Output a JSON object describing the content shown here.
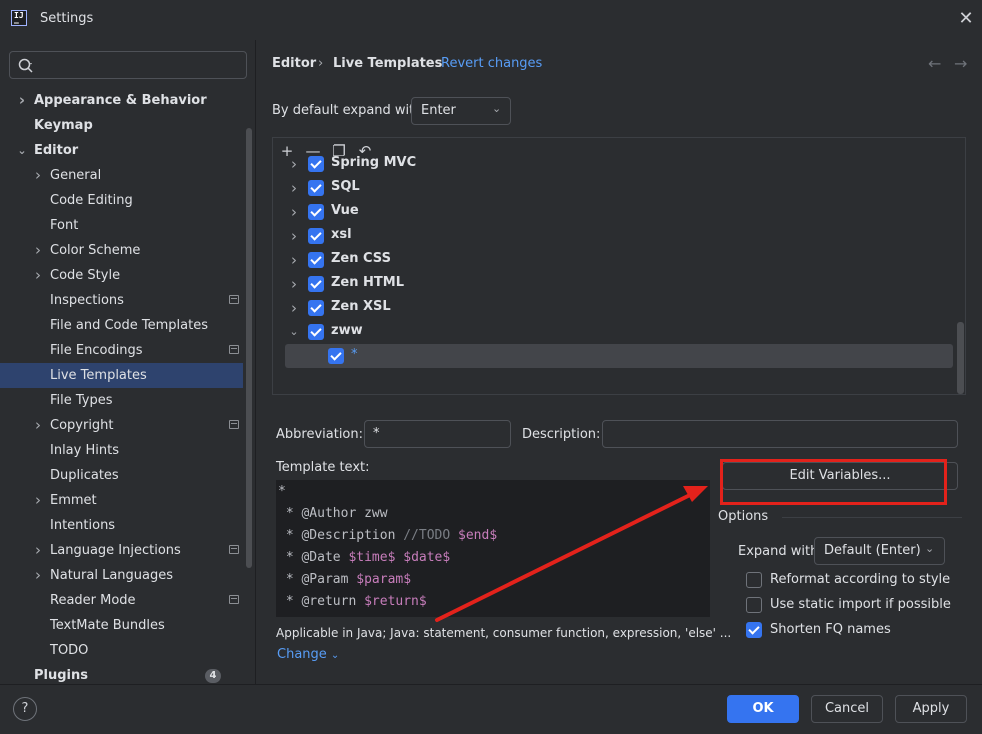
{
  "window": {
    "title": "Settings",
    "close_icon": "close-icon"
  },
  "search": {
    "placeholder": ""
  },
  "nav": {
    "items": [
      {
        "label": "Appearance & Behavior",
        "bold": true,
        "chevron": "right",
        "level": 0
      },
      {
        "label": "Keymap",
        "bold": true,
        "chevron": "",
        "level": 0
      },
      {
        "label": "Editor",
        "bold": true,
        "chevron": "down",
        "level": 0
      },
      {
        "label": "General",
        "chevron": "right",
        "level": 1
      },
      {
        "label": "Code Editing",
        "chevron": "",
        "level": 1
      },
      {
        "label": "Font",
        "chevron": "",
        "level": 1
      },
      {
        "label": "Color Scheme",
        "chevron": "right",
        "level": 1
      },
      {
        "label": "Code Style",
        "chevron": "right",
        "level": 1
      },
      {
        "label": "Inspections",
        "chevron": "",
        "level": 1,
        "indicator": true
      },
      {
        "label": "File and Code Templates",
        "chevron": "",
        "level": 1
      },
      {
        "label": "File Encodings",
        "chevron": "",
        "level": 1,
        "indicator": true
      },
      {
        "label": "Live Templates",
        "chevron": "",
        "level": 1,
        "selected": true
      },
      {
        "label": "File Types",
        "chevron": "",
        "level": 1
      },
      {
        "label": "Copyright",
        "chevron": "right",
        "level": 1,
        "indicator": true
      },
      {
        "label": "Inlay Hints",
        "chevron": "",
        "level": 1
      },
      {
        "label": "Duplicates",
        "chevron": "",
        "level": 1
      },
      {
        "label": "Emmet",
        "chevron": "right",
        "level": 1
      },
      {
        "label": "Intentions",
        "chevron": "",
        "level": 1
      },
      {
        "label": "Language Injections",
        "chevron": "right",
        "level": 1,
        "indicator": true
      },
      {
        "label": "Natural Languages",
        "chevron": "right",
        "level": 1
      },
      {
        "label": "Reader Mode",
        "chevron": "",
        "level": 1,
        "indicator": true
      },
      {
        "label": "TextMate Bundles",
        "chevron": "",
        "level": 1
      },
      {
        "label": "TODO",
        "chevron": "",
        "level": 1
      },
      {
        "label": "Plugins",
        "bold": true,
        "chevron": "",
        "level": 0,
        "badge": "4"
      }
    ]
  },
  "breadcrumb": {
    "part1": "Editor",
    "separator": "›",
    "part2": "Live Templates",
    "revert": "Revert changes",
    "back": "←",
    "forward": "→"
  },
  "expand": {
    "label": "By default expand with",
    "value": "Enter"
  },
  "tree": {
    "toolbar": [
      {
        "icon": "add-icon",
        "glyph": "+"
      },
      {
        "icon": "remove-icon",
        "glyph": "—"
      },
      {
        "icon": "copy-icon",
        "glyph": "❐"
      },
      {
        "icon": "undo-icon",
        "glyph": "↶"
      }
    ],
    "rows": [
      {
        "label": "Spring MVC",
        "expanded": false
      },
      {
        "label": "SQL",
        "expanded": false
      },
      {
        "label": "Vue",
        "expanded": false
      },
      {
        "label": "xsl",
        "expanded": false
      },
      {
        "label": "Zen CSS",
        "expanded": false
      },
      {
        "label": "Zen HTML",
        "expanded": false
      },
      {
        "label": "Zen XSL",
        "expanded": false
      },
      {
        "label": "zww",
        "expanded": true
      },
      {
        "label": "*",
        "child": true,
        "selected": true
      }
    ]
  },
  "abbreviation": {
    "label": "Abbreviation:",
    "value": "*"
  },
  "description": {
    "label": "Description:",
    "value": ""
  },
  "template": {
    "label": "Template text:",
    "lines": [
      "*",
      " * @Author zww",
      " * @Description //TODO $end$",
      " * @Date $time$ $date$",
      " * @Param $param$",
      " * @return $return$"
    ]
  },
  "applicable": {
    "text": "Applicable in Java; Java: statement, consumer function, expression, 'else' ...",
    "change": "Change"
  },
  "edit_variables": {
    "label": "Edit Variables..."
  },
  "options": {
    "title": "Options",
    "expand_label": "Expand with",
    "expand_value": "Default (Enter)",
    "checks": [
      {
        "label": "Reformat according to style",
        "checked": false
      },
      {
        "label": "Use static import if possible",
        "checked": false
      },
      {
        "label": "Shorten FQ names",
        "checked": true
      }
    ]
  },
  "footer": {
    "help": "?",
    "ok": "OK",
    "cancel": "Cancel",
    "apply": "Apply"
  },
  "colors": {
    "accent": "#3574f0",
    "link": "#589df6",
    "annotation": "#e3221b",
    "background": "#2b2d30",
    "selection": "#2e436e"
  }
}
